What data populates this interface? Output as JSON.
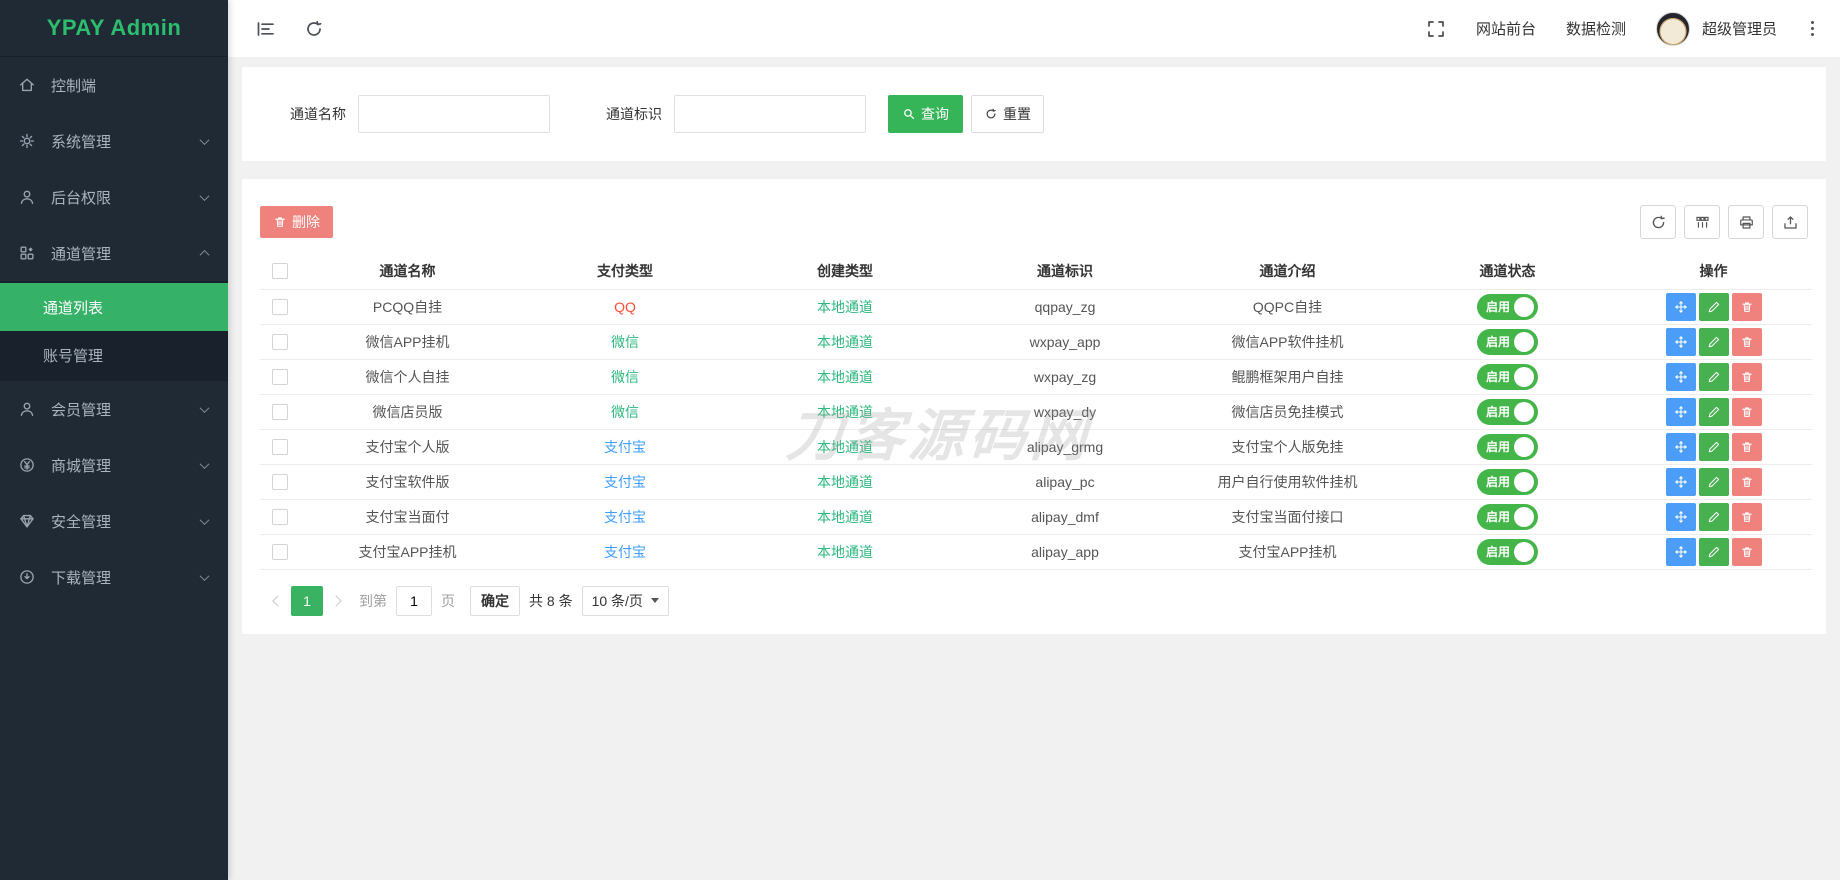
{
  "app": {
    "title": "YPAY Admin"
  },
  "topbar": {
    "site_link": "网站前台",
    "data_check_link": "数据检测",
    "username": "超级管理员"
  },
  "sidebar": {
    "items": [
      {
        "label": "控制端",
        "icon": "home-icon",
        "chevron": ""
      },
      {
        "label": "系统管理",
        "icon": "gear-icon",
        "chevron": "down"
      },
      {
        "label": "后台权限",
        "icon": "user-icon",
        "chevron": "down"
      },
      {
        "label": "通道管理",
        "icon": "grid-icon",
        "chevron": "up",
        "expanded": true,
        "children": [
          {
            "label": "通道列表",
            "active": true
          },
          {
            "label": "账号管理",
            "active": false
          }
        ]
      },
      {
        "label": "会员管理",
        "icon": "member-icon",
        "chevron": "down"
      },
      {
        "label": "商城管理",
        "icon": "yuan-icon",
        "chevron": "down"
      },
      {
        "label": "安全管理",
        "icon": "gem-icon",
        "chevron": "down"
      },
      {
        "label": "下载管理",
        "icon": "download-icon",
        "chevron": "down"
      }
    ]
  },
  "search": {
    "name_label": "通道名称",
    "name_value": "",
    "code_label": "通道标识",
    "code_value": "",
    "query_button": "查询",
    "reset_button": "重置"
  },
  "toolbar": {
    "delete_button": "删除"
  },
  "table": {
    "headers": [
      "通道名称",
      "支付类型",
      "创建类型",
      "通道标识",
      "通道介绍",
      "通道状态",
      "操作"
    ],
    "create_type_color": "#2eb87f",
    "status_on_label": "启用",
    "rows": [
      {
        "name": "PCQQ自挂",
        "pay_type": "QQ",
        "pay_type_color": "#ff4d3a",
        "create_type": "本地通道",
        "code": "qqpay_zg",
        "desc": "QQPC自挂",
        "status": "启用"
      },
      {
        "name": "微信APP挂机",
        "pay_type": "微信",
        "pay_type_color": "#2eb87f",
        "create_type": "本地通道",
        "code": "wxpay_app",
        "desc": "微信APP软件挂机",
        "status": "启用"
      },
      {
        "name": "微信个人自挂",
        "pay_type": "微信",
        "pay_type_color": "#2eb87f",
        "create_type": "本地通道",
        "code": "wxpay_zg",
        "desc": "鲲鹏框架用户自挂",
        "status": "启用"
      },
      {
        "name": "微信店员版",
        "pay_type": "微信",
        "pay_type_color": "#2eb87f",
        "create_type": "本地通道",
        "code": "wxpay_dy",
        "desc": "微信店员免挂模式",
        "status": "启用"
      },
      {
        "name": "支付宝个人版",
        "pay_type": "支付宝",
        "pay_type_color": "#409eff",
        "create_type": "本地通道",
        "code": "alipay_grmg",
        "desc": "支付宝个人版免挂",
        "status": "启用"
      },
      {
        "name": "支付宝软件版",
        "pay_type": "支付宝",
        "pay_type_color": "#409eff",
        "create_type": "本地通道",
        "code": "alipay_pc",
        "desc": "用户自行使用软件挂机",
        "status": "启用"
      },
      {
        "name": "支付宝当面付",
        "pay_type": "支付宝",
        "pay_type_color": "#409eff",
        "create_type": "本地通道",
        "code": "alipay_dmf",
        "desc": "支付宝当面付接口",
        "status": "启用"
      },
      {
        "name": "支付宝APP挂机",
        "pay_type": "支付宝",
        "pay_type_color": "#409eff",
        "create_type": "本地通道",
        "code": "alipay_app",
        "desc": "支付宝APP挂机",
        "status": "启用"
      }
    ]
  },
  "pagination": {
    "current_page": "1",
    "goto_prefix": "到第",
    "goto_value": "1",
    "goto_suffix": "页",
    "confirm_button": "确定",
    "total_text": "共 8 条",
    "page_size": "10 条/页"
  },
  "watermark": "刀客源码网",
  "colors": {
    "sidebar_bg": "#1f2a35",
    "accent_green": "#36b558",
    "status_green": "#44b549",
    "delete_pink": "#f0827d",
    "action_blue": "#4b9df7",
    "action_green": "#47b04f",
    "link_green": "#2eb87f",
    "link_blue": "#409eff",
    "qq_red": "#ff4d3a"
  }
}
